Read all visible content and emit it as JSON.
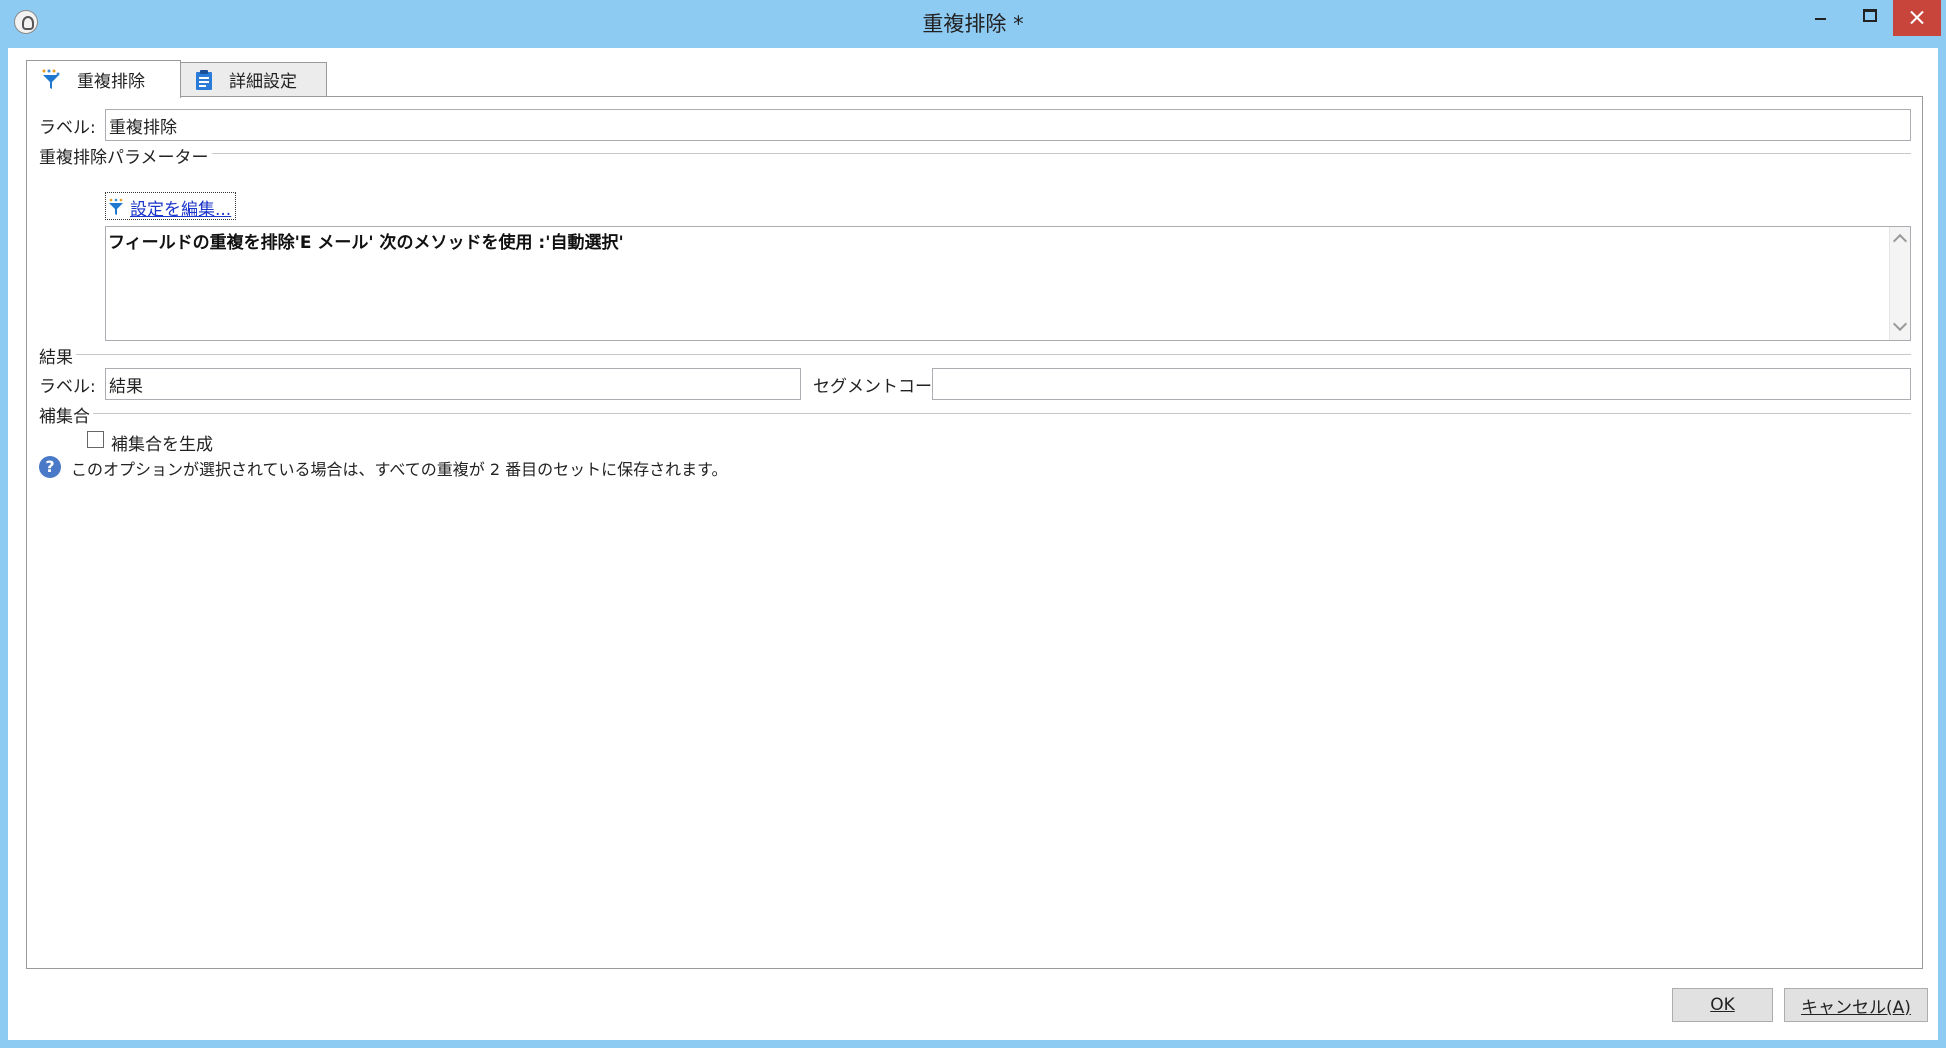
{
  "window": {
    "title": "重複排除 *",
    "icons": {
      "app": "app-icon",
      "minimize": "minimize-icon",
      "maximize": "maximize-icon",
      "close": "close-icon"
    }
  },
  "tabs": [
    {
      "label": "重複排除",
      "icon": "dedup-funnel-icon",
      "active": true
    },
    {
      "label": "詳細設定",
      "icon": "clipboard-icon",
      "active": false
    }
  ],
  "general": {
    "label_caption": "ラベル:",
    "label_value": "重複排除"
  },
  "dedup_params": {
    "section_title": "重複排除パラメーター",
    "edit_link": "設定を編集...",
    "edit_icon": "funnel-icon",
    "summary": "フィールドの重複を排除'E メール' 次のメソッドを使用 :'自動選択'"
  },
  "result": {
    "section_title": "結果",
    "label_caption": "ラベル:",
    "label_value": "結果",
    "segment_caption": "セグメントコード:",
    "segment_value": ""
  },
  "complement": {
    "section_title": "補集合",
    "checkbox_label": "補集合を生成",
    "checked": false,
    "help_text": "このオプションが選択されている場合は、すべての重複が 2 番目のセットに保存されます。"
  },
  "buttons": {
    "ok": "OK",
    "cancel": "キャンセル(A)"
  }
}
